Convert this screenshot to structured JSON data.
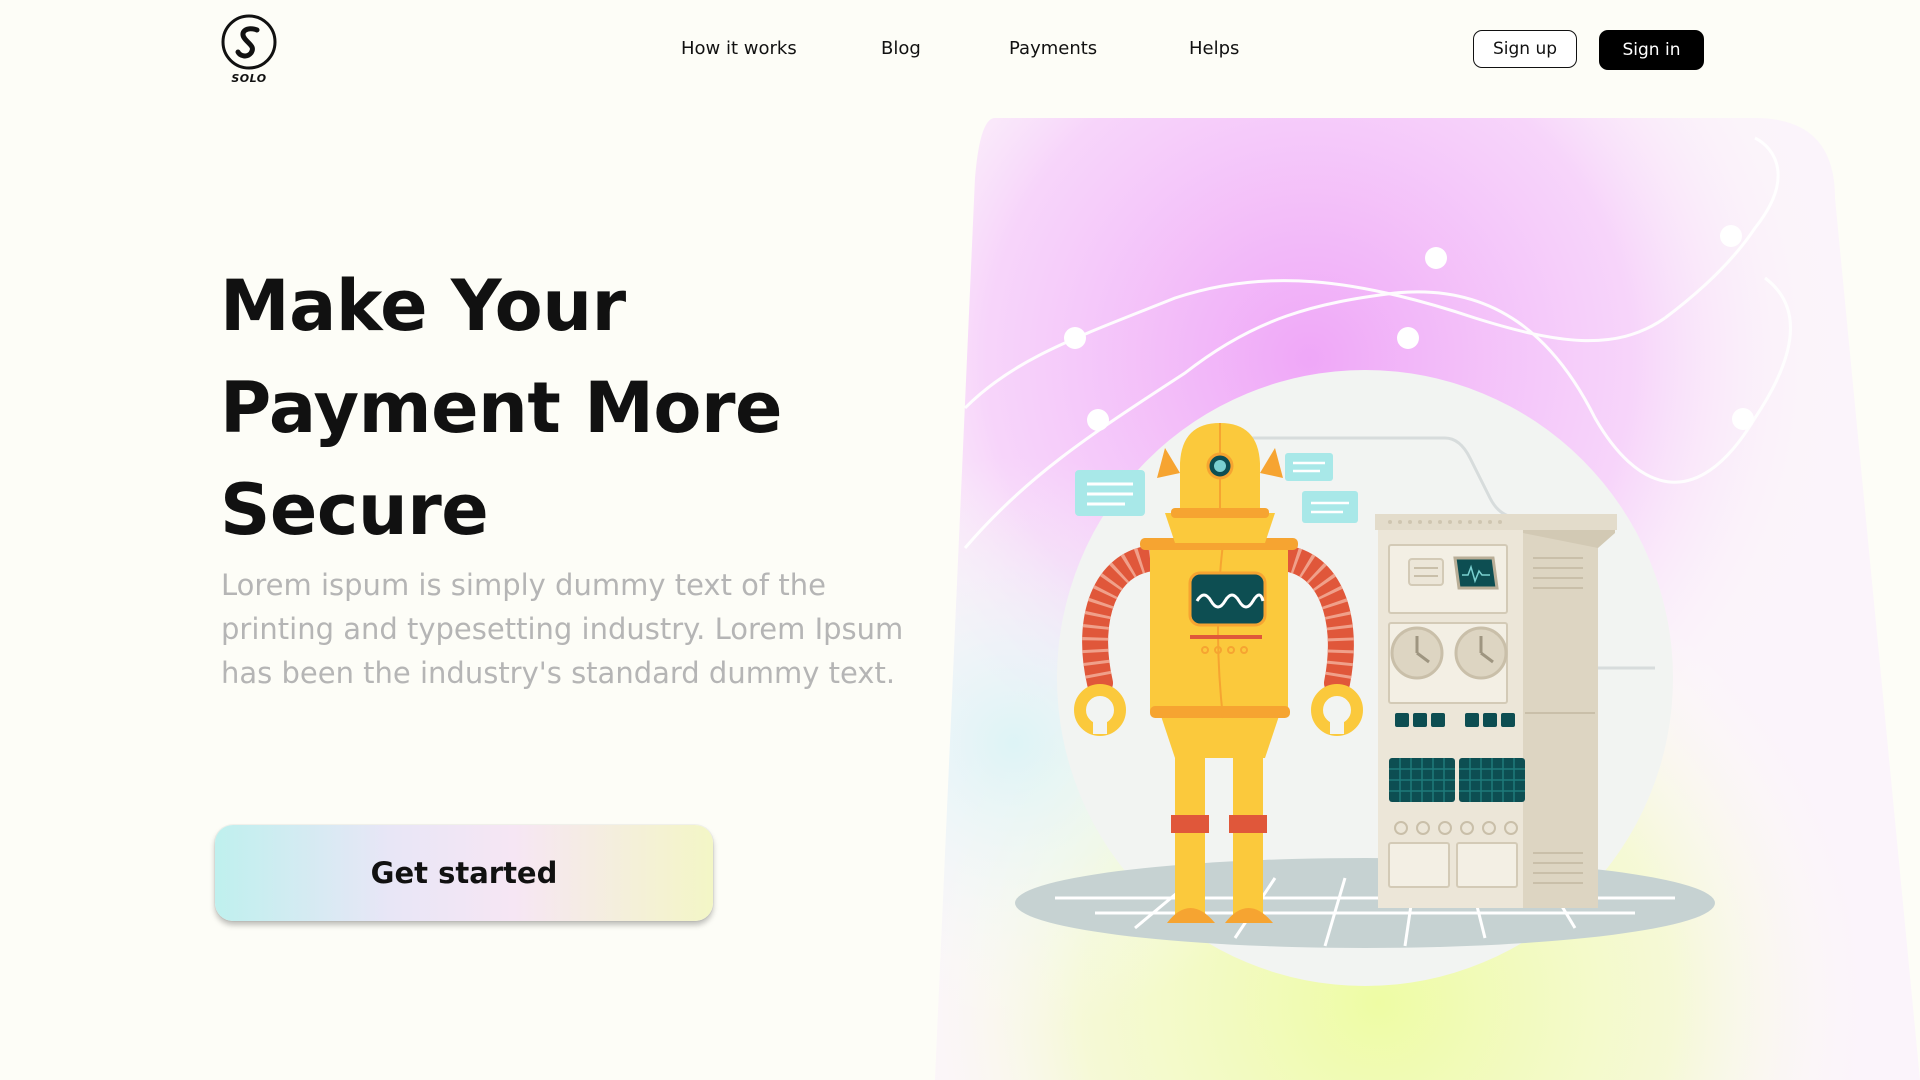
{
  "brand": {
    "name": "SOLO"
  },
  "nav": {
    "items": [
      {
        "label": "How it works"
      },
      {
        "label": "Blog"
      },
      {
        "label": "Payments"
      },
      {
        "label": "Helps"
      }
    ],
    "signup_label": "Sign up",
    "signin_label": "Sign in"
  },
  "hero": {
    "headline_lines": [
      "Make Your",
      "Payment More",
      "Secure"
    ],
    "subtext": "Lorem ispum is simply dummy text of the printing and typesetting industry. Lorem Ipsum has been the industry's standard dummy text.",
    "cta_label": "Get started"
  },
  "colors": {
    "background": "#fdfdf7",
    "primary_button": "#000000",
    "robot_body": "#fbc93c",
    "robot_arm": "#e0573a",
    "screen": "#0d4e52",
    "machine": "#ece6d8"
  },
  "icons": {
    "logo": "solo-s-icon"
  }
}
